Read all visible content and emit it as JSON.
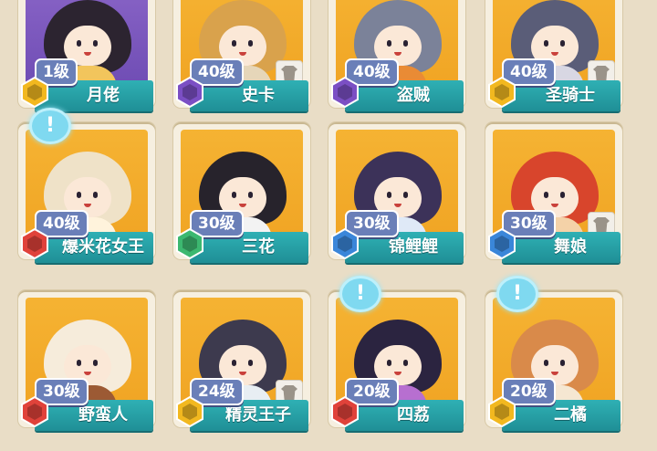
{
  "rows": [
    [
      {
        "name": "月佬",
        "level": "1级",
        "rarity": "gold",
        "hair": "#2c2430",
        "outfit": "#f2c55c",
        "bg": "purple",
        "bubble": false,
        "shirt": false
      },
      {
        "name": "史卡",
        "level": "40级",
        "rarity": "purple",
        "hair": "#d9a24c",
        "outfit": "#e6d6b9",
        "bg": "gold",
        "bubble": false,
        "shirt": true
      },
      {
        "name": "盗贼",
        "level": "40级",
        "rarity": "purple",
        "hair": "#7b8299",
        "outfit": "#e98b35",
        "bg": "gold",
        "bubble": false,
        "shirt": false
      },
      {
        "name": "圣骑士",
        "level": "40级",
        "rarity": "gold",
        "hair": "#5a5d78",
        "outfit": "#d8d7e3",
        "bg": "gold",
        "bubble": false,
        "shirt": true
      }
    ],
    [
      {
        "name": "爆米花女王",
        "level": "40级",
        "rarity": "red",
        "hair": "#efe2c8",
        "outfit": "#fff3dc",
        "bg": "gold",
        "bubble": true,
        "shirt": false
      },
      {
        "name": "三花",
        "level": "30级",
        "rarity": "green",
        "hair": "#27232c",
        "outfit": "#f3f3f3",
        "bg": "gold",
        "bubble": false,
        "shirt": false
      },
      {
        "name": "锦鲤鲤",
        "level": "30级",
        "rarity": "blue",
        "hair": "#3c3259",
        "outfit": "#dfe9f7",
        "bg": "gold",
        "bubble": false,
        "shirt": false
      },
      {
        "name": "舞娘",
        "level": "30级",
        "rarity": "blue",
        "hair": "#d8452c",
        "outfit": "#f4d2a8",
        "bg": "gold",
        "bubble": false,
        "shirt": true
      }
    ],
    [
      {
        "name": "野蛮人",
        "level": "30级",
        "rarity": "red",
        "hair": "#f6ecdb",
        "outfit": "#9c5a34",
        "bg": "gold",
        "bubble": false,
        "shirt": false
      },
      {
        "name": "精灵王子",
        "level": "24级",
        "rarity": "gold",
        "hair": "#3d3a4e",
        "outfit": "#e8eef3",
        "bg": "gold",
        "bubble": false,
        "shirt": true
      },
      {
        "name": "四荔",
        "level": "20级",
        "rarity": "red",
        "hair": "#2b2440",
        "outfit": "#b76fd0",
        "bg": "gold",
        "bubble": true,
        "shirt": false
      },
      {
        "name": "二橘",
        "level": "20级",
        "rarity": "gold",
        "hair": "#d98a4a",
        "outfit": "#f5e7d2",
        "bg": "gold",
        "bubble": true,
        "shirt": false
      }
    ]
  ],
  "colors": {
    "gold": "#f2b81f",
    "purple": "#7b4fc4",
    "red": "#e0423a",
    "green": "#3cb870",
    "blue": "#3a86d9"
  },
  "icons": {
    "bubble": "exclamation-bubble-icon",
    "shirt": "outfit-shirt-icon",
    "rarity": "rarity-hexagon-icon"
  }
}
